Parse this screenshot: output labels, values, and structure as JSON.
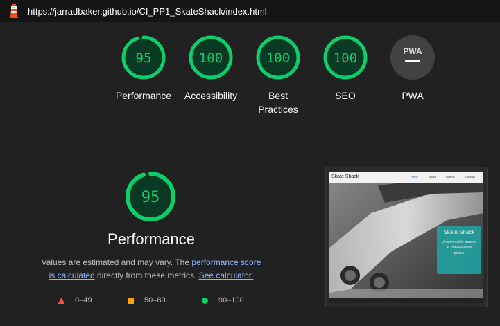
{
  "browser": {
    "url": "https://jarradbaker.github.io/CI_PP1_SkateShack/index.html"
  },
  "gauges": [
    {
      "label": "Performance",
      "score": "95",
      "fraction": 0.95,
      "color": "#0cce6b"
    },
    {
      "label": "Accessibility",
      "score": "100",
      "fraction": 1.0,
      "color": "#0cce6b"
    },
    {
      "label_line1": "Best",
      "label_line2": "Practices",
      "score": "100",
      "fraction": 1.0,
      "color": "#0cce6b"
    },
    {
      "label": "SEO",
      "score": "100",
      "fraction": 1.0,
      "color": "#0cce6b"
    }
  ],
  "pwa": {
    "label": "PWA",
    "badge_text": "PWA"
  },
  "performance": {
    "score": "95",
    "fraction": 0.95,
    "title": "Performance",
    "desc_prefix": "Values are estimated and may vary. The ",
    "link_score": "performance score",
    "link_calc": "is calculated",
    "desc_mid": " directly from these metrics. ",
    "link_calculator": "See calculator."
  },
  "legend": [
    {
      "range": "0–49",
      "color": "#ff4e42",
      "shape": "triangle"
    },
    {
      "range": "50–89",
      "color": "#ffa400",
      "shape": "square"
    },
    {
      "range": "90–100",
      "color": "#0cce6b",
      "shape": "circle"
    }
  ],
  "screenshot": {
    "brand": "Skate Shack",
    "nav": [
      "Home",
      "Tricks",
      "Boards",
      "Contact"
    ],
    "card_title": "Skate Shack",
    "card_text": "Unbelievable boards at unbelievable prices"
  },
  "colors": {
    "pass": "#0cce6b",
    "pass_bg": "#0b3a24",
    "background": "#212121"
  }
}
